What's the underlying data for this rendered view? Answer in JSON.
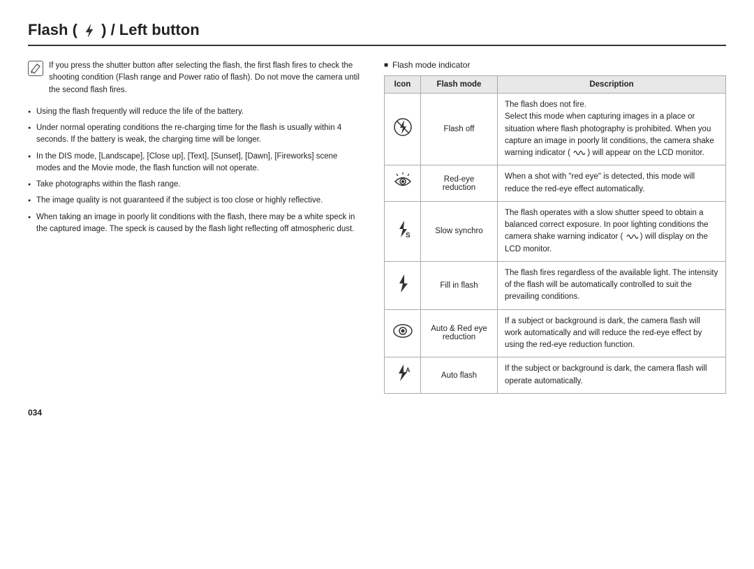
{
  "title": "Flash (  ) / Left button",
  "page_number": "034",
  "note": {
    "icon": "✎",
    "paragraphs": [
      "If you press the shutter button after selecting the flash, the first flash fires to check the shooting condition (Flash range and Power ratio of flash). Do not move the camera until the second flash fires."
    ]
  },
  "bullets": [
    "Using the flash frequently will reduce the life of the battery.",
    "Under normal operating conditions the re-charging time for the flash is usually within 4 seconds. If the battery is weak, the charging time will be longer.",
    "In the DIS mode, [Landscape], [Close up], [Text], [Sunset], [Dawn], [Fireworks] scene modes and the Movie mode, the flash function will not operate.",
    "Take photographs within the flash range.",
    "The image quality is not guaranteed if the subject is too close or highly reflective.",
    "When taking an image in poorly lit conditions with the flash, there may be a white speck in the captured image. The speck is caused by the flash light reflecting off atmospheric dust."
  ],
  "table": {
    "label": "Flash mode indicator",
    "columns": [
      "Icon",
      "Flash mode",
      "Description"
    ],
    "rows": [
      {
        "icon_type": "flash-off",
        "mode": "Flash off",
        "description": "The flash does not fire.\nSelect this mode when capturing images in a place or situation where flash photography is prohibited. When you capture an image in poorly lit conditions, the camera shake warning indicator (  ) will appear on the LCD monitor."
      },
      {
        "icon_type": "red-eye-reduction",
        "mode": "Red-eye reduction",
        "description": "When a shot with \"red eye\" is detected, this mode will reduce the red-eye effect automatically."
      },
      {
        "icon_type": "slow-synchro",
        "mode": "Slow synchro",
        "description": "The flash operates with a slow shutter speed to obtain a balanced correct exposure. In poor lighting conditions the camera shake warning indicator (  ) will display on the LCD monitor."
      },
      {
        "icon_type": "fill-in-flash",
        "mode": "Fill in flash",
        "description": "The flash fires regardless of the available light. The intensity of the flash will be automatically controlled to suit the prevailing conditions."
      },
      {
        "icon_type": "auto-red-eye",
        "mode": "Auto & Red eye reduction",
        "description": "If a subject or background is dark, the camera flash will work automatically and will reduce the red-eye effect by using the red-eye reduction function."
      },
      {
        "icon_type": "auto-flash",
        "mode": "Auto flash",
        "description": "If the subject or background is dark, the camera flash will operate automatically."
      }
    ]
  }
}
